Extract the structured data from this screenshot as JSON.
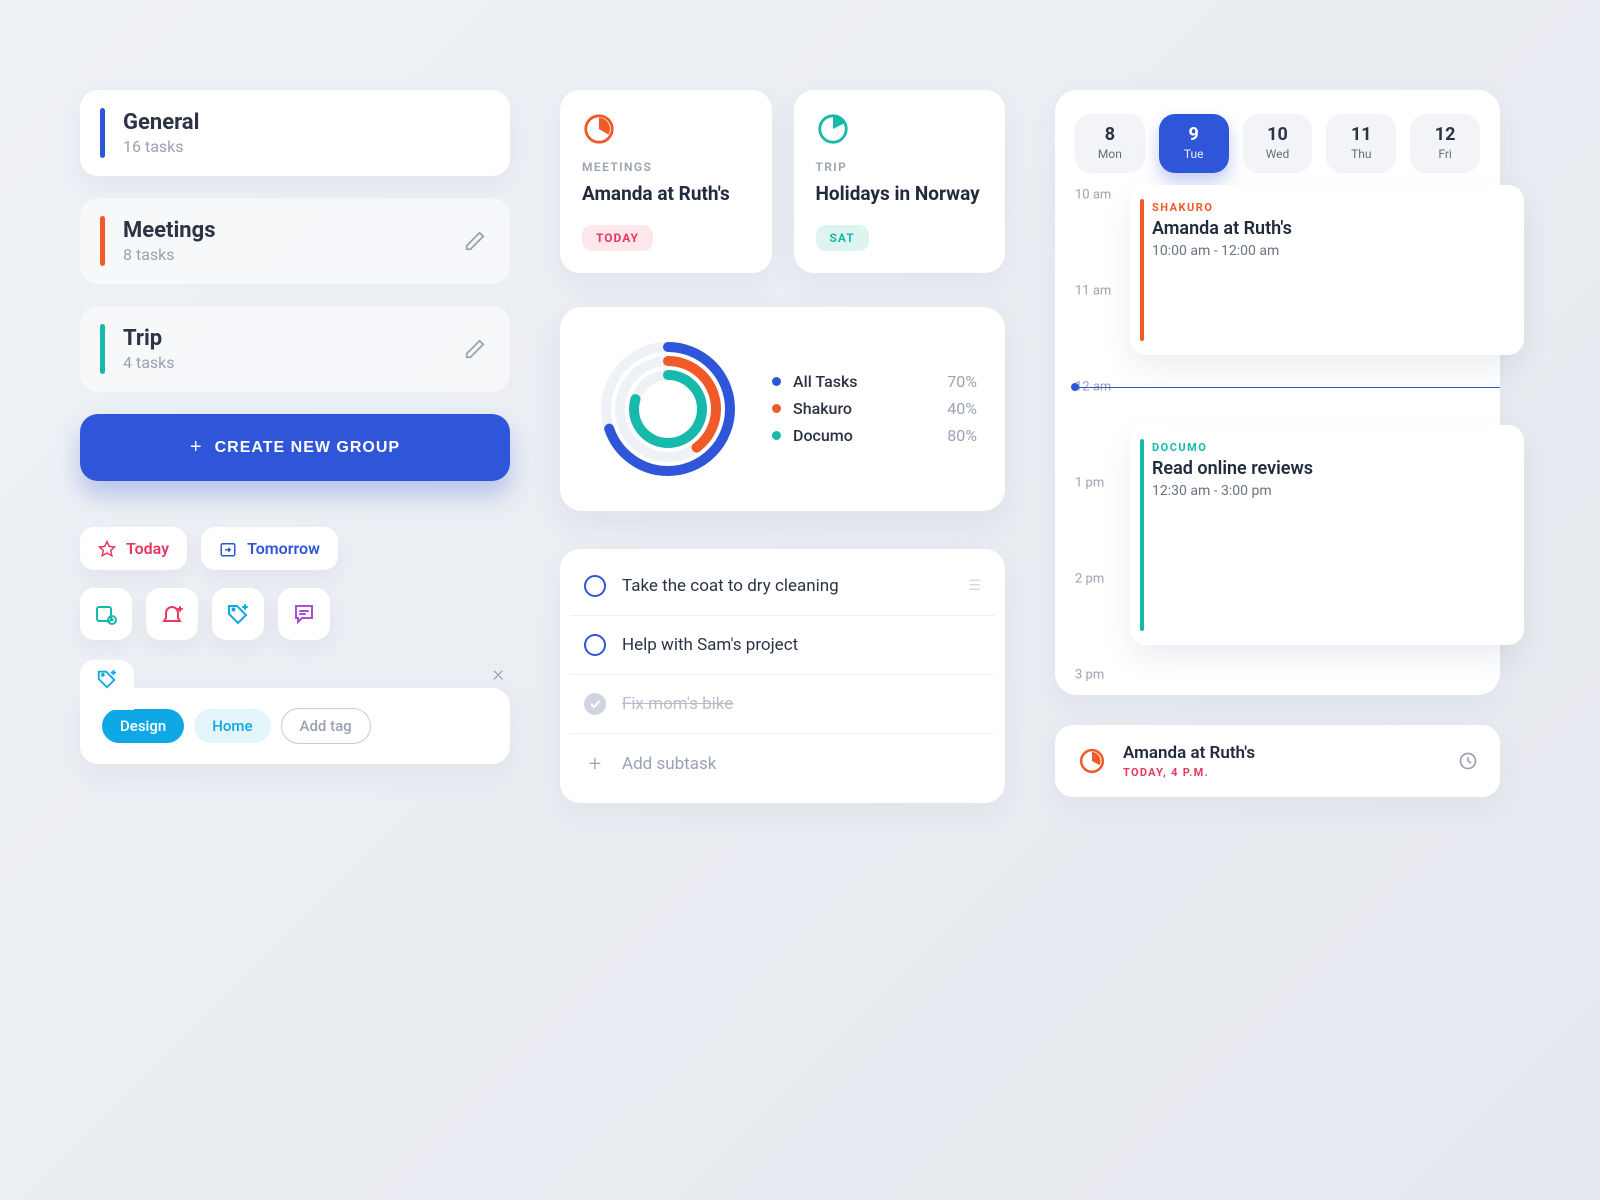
{
  "colors": {
    "blue": "#2f56d9",
    "orange": "#f05a28",
    "teal": "#17b9ab",
    "pink": "#e8385f",
    "cyan": "#0ea8e6",
    "purple": "#a44fd6"
  },
  "groups": [
    {
      "name": "General",
      "tasks_label": "16 tasks",
      "color": "#2f56d9",
      "editable": false
    },
    {
      "name": "Meetings",
      "tasks_label": "8 tasks",
      "color": "#f05a28",
      "editable": true
    },
    {
      "name": "Trip",
      "tasks_label": "4 tasks",
      "color": "#17b9ab",
      "editable": true
    }
  ],
  "create_button": "CREATE NEW GROUP",
  "quick_filters": {
    "today": "Today",
    "tomorrow": "Tomorrow"
  },
  "tag_editor": {
    "tags": [
      "Design",
      "Home"
    ],
    "add_placeholder": "Add tag"
  },
  "tiles": [
    {
      "category": "MEETINGS",
      "title": "Amanda at Ruth's",
      "badge": "TODAY",
      "badge_style": "today",
      "color": "#f05a28"
    },
    {
      "category": "TRIP",
      "title": "Holidays in Norway",
      "badge": "SAT",
      "badge_style": "sat",
      "color": "#17b9ab"
    }
  ],
  "chart_data": {
    "type": "radial",
    "series": [
      {
        "name": "All Tasks",
        "value": 70,
        "label": "70%",
        "color": "#2f56d9"
      },
      {
        "name": "Shakuro",
        "value": 40,
        "label": "40%",
        "color": "#f05a28"
      },
      {
        "name": "Documo",
        "value": 80,
        "label": "80%",
        "color": "#17b9ab"
      }
    ]
  },
  "subtasks": {
    "items": [
      {
        "text": "Take the coat to dry cleaning",
        "done": false
      },
      {
        "text": "Help with Sam's project",
        "done": false
      },
      {
        "text": "Fix mom's bike",
        "done": true
      }
    ],
    "add_label": "Add subtask"
  },
  "calendar": {
    "days": [
      {
        "num": "8",
        "name": "Mon",
        "active": false
      },
      {
        "num": "9",
        "name": "Tue",
        "active": true
      },
      {
        "num": "10",
        "name": "Wed",
        "active": false
      },
      {
        "num": "11",
        "name": "Thu",
        "active": false
      },
      {
        "num": "12",
        "name": "Fri",
        "active": false
      }
    ],
    "hours": [
      "10 am",
      "11 am",
      "12 am",
      "1 pm",
      "2 pm",
      "3 pm"
    ],
    "now_at_hour_index": 2,
    "events": [
      {
        "tag": "SHAKURO",
        "tag_color": "#f05a28",
        "title": "Amanda at Ruth's",
        "time": "10:00 am - 12:00 am",
        "start_idx": 0,
        "span": 2
      },
      {
        "tag": "DOCUMO",
        "tag_color": "#17b9ab",
        "title": "Read online reviews",
        "time": "12:30 am - 3:00 pm",
        "start_idx": 2.4,
        "span": 2.5
      }
    ]
  },
  "notification": {
    "title": "Amanda at Ruth's",
    "sub": "TODAY, 4 P.M."
  }
}
